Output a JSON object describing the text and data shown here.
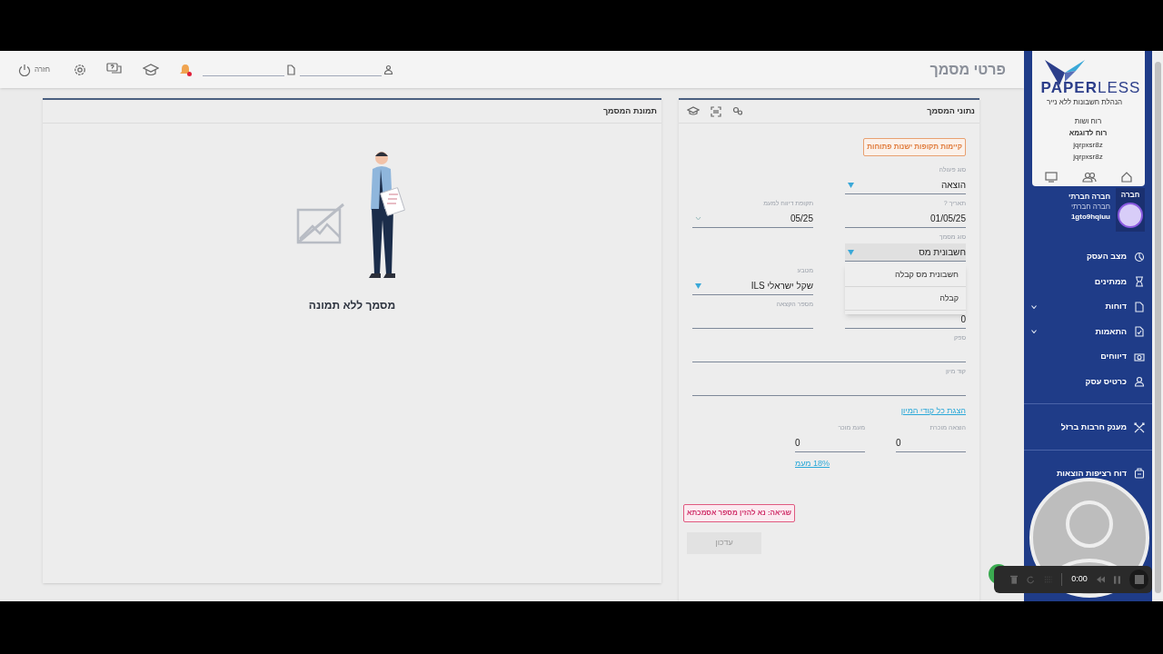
{
  "topbar": {
    "title": "פרטי מסמך",
    "logout_label": "חזרה",
    "notifications": {
      "unread": true
    }
  },
  "image_panel": {
    "title": "תמונת המסמך",
    "empty_text": "מסמך ללא תמונה"
  },
  "form_panel": {
    "title": "נתוני המסמך",
    "warning_badge": "קיימות תקופות ישנות פתוחות",
    "rows": [
      {
        "right": {
          "label": "סוג פעולה",
          "value": "הוצאה",
          "kind": "select"
        }
      },
      {
        "right": {
          "label": "תאריך ?",
          "value": "01/05/25"
        },
        "left": {
          "label": "תקופת דיווח למעמ",
          "value": "05/25",
          "kind": "chevron"
        }
      },
      {
        "right": {
          "label": "סוג מסמך",
          "value": "חשבונית מס",
          "kind": "select",
          "open": true,
          "options": [
            "חשבונית מס קבלה",
            "קבלה"
          ]
        }
      },
      {
        "left": {
          "label": "מטבע",
          "value": "שקל ישראלי ILS",
          "kind": "select"
        }
      },
      {
        "right": {
          "value": "0"
        },
        "left": {
          "label": "מספר הקצאה"
        }
      },
      {
        "full": {
          "label": "ספק"
        }
      },
      {
        "full": {
          "label": "קוד מיון"
        }
      }
    ],
    "codes_link": "הצגת כל קודי המיון",
    "amounts": [
      {
        "label": "הוצאה מוכרת",
        "value": "0"
      },
      {
        "label": "מעמ מוכר",
        "value": "0",
        "link": "18% מעמ"
      }
    ],
    "error_badge": "שגיאה: נא להזין מספר אסמכתא",
    "submit": {
      "label": "עדכון",
      "disabled": true
    }
  },
  "sidebar": {
    "logo": {
      "bold": "PAPER",
      "light": "LESS",
      "tagline": "הנהלת חשבונות ללא נייר"
    },
    "account_lines": [
      {
        "text": "רוח ושות",
        "bold": false
      },
      {
        "text": "רוח לדוגמא",
        "bold": true
      },
      {
        "text": "jqrpxsr8z",
        "bold": false
      },
      {
        "text": "jqrpxsr8z",
        "bold": false
      }
    ],
    "company": {
      "tag": "חברה",
      "name": "חברה חברתי",
      "subtitle": "חברה חברתי",
      "code": "1gto9hqiuu"
    },
    "groups": [
      [
        {
          "label": "מצב העסק",
          "has_submenu": false
        },
        {
          "label": "ממתינים",
          "has_submenu": false
        },
        {
          "label": "דוחות",
          "has_submenu": true
        },
        {
          "label": "התאמות",
          "has_submenu": true
        },
        {
          "label": "דיווחים",
          "has_submenu": false
        },
        {
          "label": "כרטיס עסק",
          "has_submenu": false
        }
      ],
      [
        {
          "label": "מענק חרבות ברזל",
          "has_submenu": false
        }
      ],
      [
        {
          "label": "דוח רציפות הוצאות",
          "has_submenu": false
        }
      ]
    ]
  },
  "recorder": {
    "time": "0:00"
  }
}
